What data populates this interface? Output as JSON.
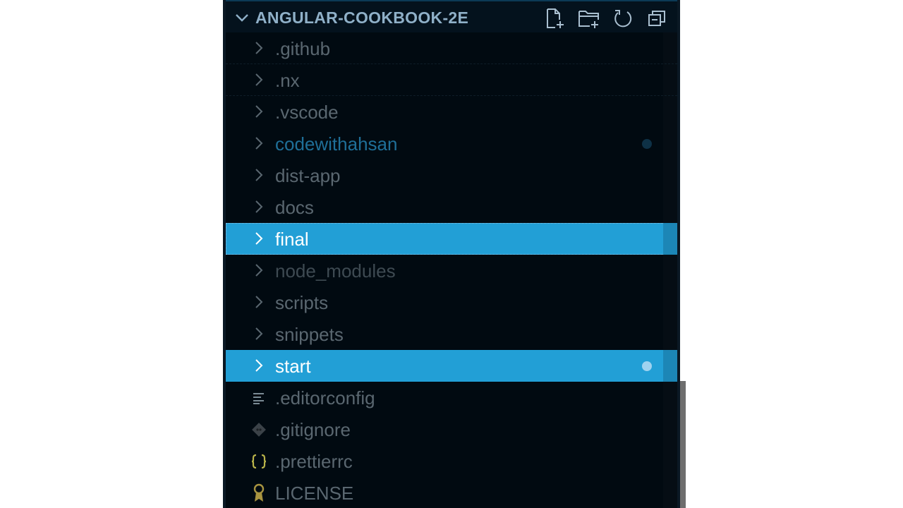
{
  "explorer": {
    "title": "ANGULAR-COOKBOOK-2E",
    "tools": [
      {
        "name": "new-file-icon"
      },
      {
        "name": "new-folder-icon"
      },
      {
        "name": "refresh-icon"
      },
      {
        "name": "collapse-all-icon"
      }
    ],
    "items": [
      {
        "label": ".github",
        "type": "folder",
        "state": "normal"
      },
      {
        "label": ".nx",
        "type": "folder",
        "state": "normal"
      },
      {
        "label": ".vscode",
        "type": "folder",
        "state": "normal"
      },
      {
        "label": "codewithahsan",
        "type": "folder",
        "state": "modified"
      },
      {
        "label": "dist-app",
        "type": "folder",
        "state": "normal"
      },
      {
        "label": "docs",
        "type": "folder",
        "state": "normal"
      },
      {
        "label": "final",
        "type": "folder",
        "state": "selected-focused"
      },
      {
        "label": "node_modules",
        "type": "folder",
        "state": "normal"
      },
      {
        "label": "scripts",
        "type": "folder",
        "state": "normal"
      },
      {
        "label": "snippets",
        "type": "folder",
        "state": "normal"
      },
      {
        "label": "start",
        "type": "folder",
        "state": "selected-modified"
      },
      {
        "label": ".editorconfig",
        "type": "file",
        "icon": "lines-icon"
      },
      {
        "label": ".gitignore",
        "type": "file",
        "icon": "git-icon"
      },
      {
        "label": ".prettierrc",
        "type": "file",
        "icon": "braces-icon"
      },
      {
        "label": "LICENSE",
        "type": "file",
        "icon": "license-icon"
      }
    ]
  },
  "colors": {
    "background": "#010a11",
    "selection": "#229fd6",
    "modified_text": "#1f6f98",
    "modified_dot": "#0e3146",
    "selected_dot": "#9fd2ef",
    "braces": "#b9b34a",
    "license": "#a89440"
  }
}
